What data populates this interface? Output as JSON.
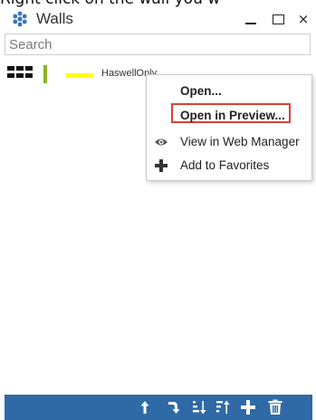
{
  "caption": {
    "text": "Right click on the wall you w"
  },
  "window": {
    "title": "Walls",
    "icon": "cluster-icon"
  },
  "controls": {
    "minimize": "minimize-icon",
    "maximize": "maximize-icon",
    "close": "×"
  },
  "search": {
    "placeholder": "Search"
  },
  "list": {
    "items": [
      {
        "label": "HaswellOnly",
        "color_bar": "#8db22a",
        "line_color": "#ffff00"
      }
    ]
  },
  "context_menu": {
    "items": [
      {
        "label": "Open...",
        "bold": true
      },
      {
        "label": "Open in Preview...",
        "bold": true,
        "highlighted": true
      },
      {
        "label": "View in Web Manager",
        "icon": "eye-icon"
      },
      {
        "label": "Add to Favorites",
        "icon": "plus-icon"
      }
    ]
  },
  "toolbar": {
    "buttons": [
      "move-up-icon",
      "move-down-icon",
      "sort-ascending-icon",
      "sort-descending-icon",
      "add-icon",
      "delete-icon"
    ],
    "background": "#2f6aa6"
  }
}
